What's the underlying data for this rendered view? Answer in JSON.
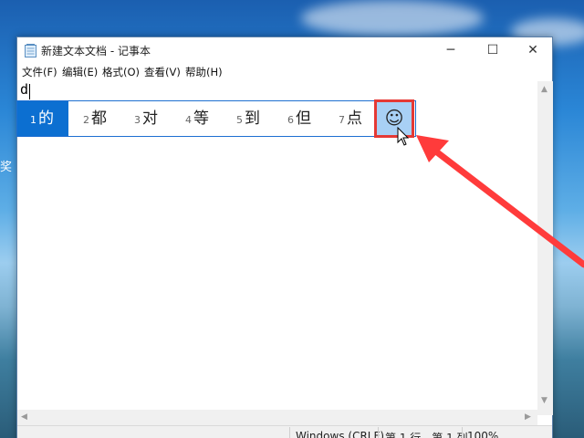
{
  "window": {
    "title": "新建文本文档 - 记事本",
    "minimize": "─",
    "maximize": "☐",
    "close": "✕"
  },
  "menu": [
    {
      "label": "文件(F)"
    },
    {
      "label": "编辑(E)"
    },
    {
      "label": "格式(O)"
    },
    {
      "label": "查看(V)"
    },
    {
      "label": "帮助(H)"
    }
  ],
  "editor": {
    "text": "d"
  },
  "ime": {
    "candidates": [
      {
        "num": "1",
        "text": "的"
      },
      {
        "num": "2",
        "text": "都"
      },
      {
        "num": "3",
        "text": "对"
      },
      {
        "num": "4",
        "text": "等"
      },
      {
        "num": "5",
        "text": "到"
      },
      {
        "num": "6",
        "text": "但"
      },
      {
        "num": "7",
        "text": "点"
      }
    ],
    "emoji": "☺"
  },
  "status": {
    "line_ending": "Windows (CRLF)",
    "position": "第 1 行，第 1 列",
    "zoom": "100%"
  },
  "desktop": {
    "fragment": "奖"
  },
  "colors": {
    "accent": "#0c6fd1",
    "highlight_box": "#e53935",
    "annotation_arrow": "#ff3b3b"
  },
  "icons": {
    "app": "notepad-icon",
    "mouse_cursor": "cursor-icon"
  }
}
